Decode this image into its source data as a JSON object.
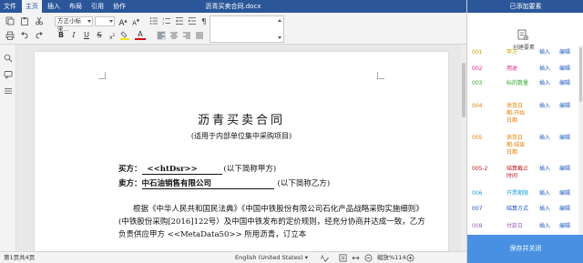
{
  "menu": {
    "tabs": [
      "文件",
      "主页",
      "插入",
      "布局",
      "引用",
      "协作"
    ],
    "active_index": 1
  },
  "document": {
    "filename": "沥青买卖合同.docx",
    "title": "沥青买卖合同",
    "subtitle": "(适用于内部单位集中采购项目)",
    "buyer_label": "买方：",
    "buyer_value": "<<htDsr>>",
    "buyer_suffix": "(以下简称甲方)",
    "seller_label": "卖方：",
    "seller_value": "中石油销售有限公司",
    "seller_suffix": "(以下简称乙方)",
    "paragraph": "根据《中华人民共和国民法典》《中国中铁股份有限公司石化产品战略采购实施细则》(中铁股份采购[2016]122号）及中国中铁发布的定价规则，经充分协商并达成一致，乙方负责供应甲方  <<MetaData50>>  所用沥青，订立本"
  },
  "toolbar": {
    "font_name": "方正小标宋...",
    "font_size": "",
    "bold": "B",
    "italic": "I",
    "underline": "U",
    "strike": "S",
    "font_color_letter": "A",
    "highlight_color": "#f5e300",
    "font_color": "#d0021b"
  },
  "statusbar": {
    "page_info": "第1页共4页",
    "language": "English (United States)",
    "zoom": "缩放%114"
  },
  "panel": {
    "title": "已添加要素",
    "create_label": "创建要素",
    "insert_label": "插入",
    "edit_label": "编辑",
    "save_label": "保存并关闭",
    "fields": [
      {
        "id": "001",
        "name": "甲方",
        "id_color": "#c8a000",
        "name_color": "#c8a000"
      },
      {
        "id": "002",
        "name": "用途",
        "id_color": "#e0218a",
        "name_color": "#e0218a"
      },
      {
        "id": "003",
        "name": "标的数量",
        "id_color": "#2eaa2e",
        "name_color": "#2eaa2e"
      },
      {
        "id": "004",
        "name": "供货日期-开始日期",
        "id_color": "#e67e00",
        "name_color": "#e67e00"
      },
      {
        "id": "005",
        "name": "供货日期-结束日期",
        "id_color": "#e67e00",
        "name_color": "#e67e00"
      },
      {
        "id": "005-2",
        "name": "结算截止时间",
        "id_color": "#c0161f",
        "name_color": "#c0161f"
      },
      {
        "id": "006",
        "name": "开票期限",
        "id_color": "#1aa0d8",
        "name_color": "#1aa0d8"
      },
      {
        "id": "007",
        "name": "结算方式",
        "id_color": "#1a4fbf",
        "name_color": "#1a4fbf"
      },
      {
        "id": "008",
        "name": "付款日",
        "id_color": "#9b59b6",
        "name_color": "#9b59b6"
      }
    ]
  },
  "colors": {
    "brand": "#2b579a",
    "save_button": "#4a90e2",
    "link": "#1f5bbf"
  }
}
